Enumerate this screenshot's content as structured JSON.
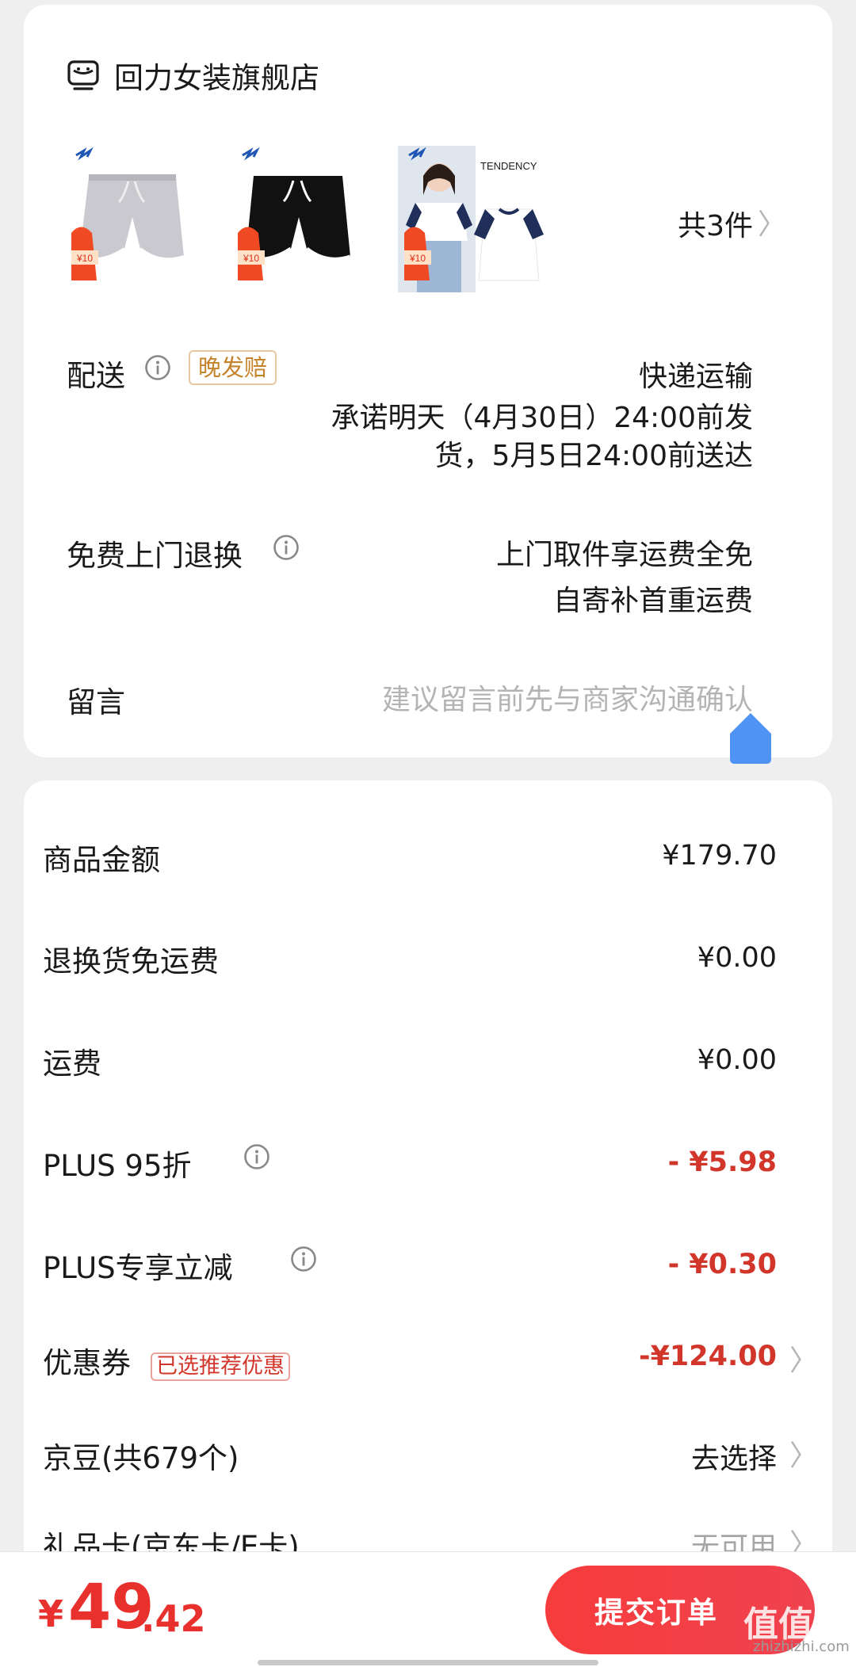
{
  "store": {
    "name": "回力女装旗舰店",
    "icon": "store-icon"
  },
  "products": {
    "thumbs": [
      {
        "name": "gray-shorts",
        "color": "#c9c9cf",
        "badge": "¥10"
      },
      {
        "name": "black-shorts",
        "color": "#111111",
        "badge": "¥10"
      },
      {
        "name": "raglan-tshirt",
        "brand_text": "TENDENCY",
        "badge": "¥10"
      }
    ],
    "quantity_label": "共3件"
  },
  "delivery": {
    "label": "配送",
    "tag": "晚发赔",
    "method": "快递运输",
    "promise_line1": "承诺明天（4月30日）24:00前发",
    "promise_line2": "货，5月5日24:00前送达"
  },
  "returns": {
    "label": "免费上门退换",
    "line1": "上门取件享运费全免",
    "line2": "自寄补首重运费"
  },
  "message": {
    "label": "留言",
    "placeholder": "建议留言前先与商家沟通确认"
  },
  "prices": {
    "goods_label": "商品金额",
    "goods_value": "¥179.70",
    "return_free_label": "退换货免运费",
    "return_free_value": "¥0.00",
    "shipping_label": "运费",
    "shipping_value": "¥0.00",
    "plus95_label": "PLUS 95折",
    "plus95_value": "- ¥5.98",
    "plus_cut_label": "PLUS专享立减",
    "plus_cut_value": "- ¥0.30",
    "coupon_label": "优惠券",
    "coupon_tag": "已选推荐优惠",
    "coupon_value": "-¥124.00",
    "jingdou_label": "京豆(共679个)",
    "jingdou_value": "去选择",
    "giftcard_label": "礼品卡(京东卡/E卡)",
    "giftcard_value": "无可用"
  },
  "footer": {
    "currency": "¥",
    "total_int": "49",
    "total_dec": ".42",
    "submit_label": "提交订单",
    "watermark": "值值值",
    "watermark_url": "zhizhizhi.com"
  },
  "colors": {
    "accent_red": "#e8302d",
    "discount_red": "#d2362a",
    "tag_gold": "#c5842c",
    "float_blue": "#4f93f5"
  }
}
